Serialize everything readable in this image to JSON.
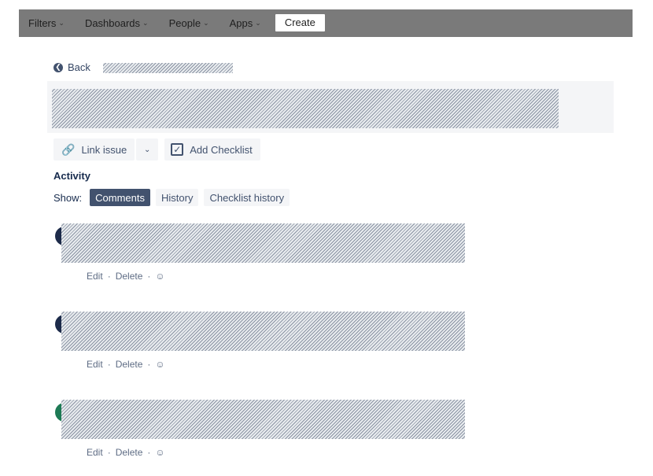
{
  "nav": {
    "items": [
      {
        "label": "Filters"
      },
      {
        "label": "Dashboards"
      },
      {
        "label": "People"
      },
      {
        "label": "Apps"
      }
    ],
    "create_label": "Create"
  },
  "back_label": "Back",
  "toolbar": {
    "link_issue": "Link issue",
    "add_checklist": "Add Checklist"
  },
  "activity": {
    "heading": "Activity",
    "show_label": "Show:",
    "tabs": [
      {
        "label": "Comments",
        "active": true
      },
      {
        "label": "History",
        "active": false
      },
      {
        "label": "Checklist history",
        "active": false
      }
    ]
  },
  "comments": [
    {
      "avatar_color": "#1d2b4a",
      "edit": "Edit",
      "delete": "Delete"
    },
    {
      "avatar_color": "#1d2b4a",
      "edit": "Edit",
      "delete": "Delete"
    },
    {
      "avatar_color": "#1e7a55",
      "edit": "Edit",
      "delete": "Delete"
    }
  ],
  "colors": {
    "active_tab": "#42526e",
    "topbar": "#7a7a7a"
  }
}
